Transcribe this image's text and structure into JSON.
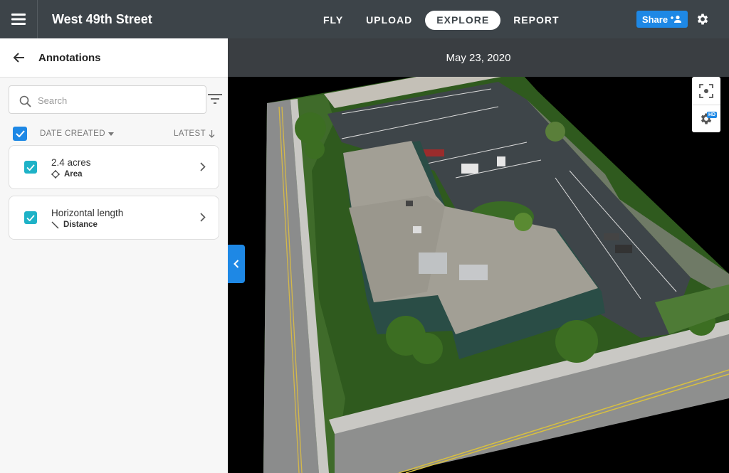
{
  "header": {
    "project_title": "West 49th Street",
    "nav": [
      {
        "label": "FLY"
      },
      {
        "label": "UPLOAD"
      },
      {
        "label": "EXPLORE"
      },
      {
        "label": "REPORT"
      }
    ],
    "active_tab": "EXPLORE",
    "share_label": "Share"
  },
  "sidebar": {
    "title": "Annotations",
    "search_placeholder": "Search",
    "sort_by_label": "DATE CREATED",
    "order_label": "LATEST",
    "annotations": [
      {
        "name": "2.4 acres",
        "type": "Area",
        "checked": true
      },
      {
        "name": "Horizontal length",
        "type": "Distance",
        "checked": true
      }
    ]
  },
  "viewer": {
    "capture_date": "May 23, 2020",
    "quality_badge": "HD"
  },
  "colors": {
    "topbar": "#3d4449",
    "accent_blue": "#1e88e5",
    "checkbox_teal": "#1eb2c7"
  },
  "icons": [
    "menu-icon",
    "settings-gear-icon",
    "add-person-icon",
    "back-arrow-icon",
    "search-icon",
    "filter-icon",
    "check-icon",
    "caret-down-icon",
    "arrow-down-icon",
    "area-icon",
    "distance-icon",
    "chevron-right-icon",
    "chevron-left-icon",
    "focus-icon",
    "viewer-settings-icon"
  ]
}
